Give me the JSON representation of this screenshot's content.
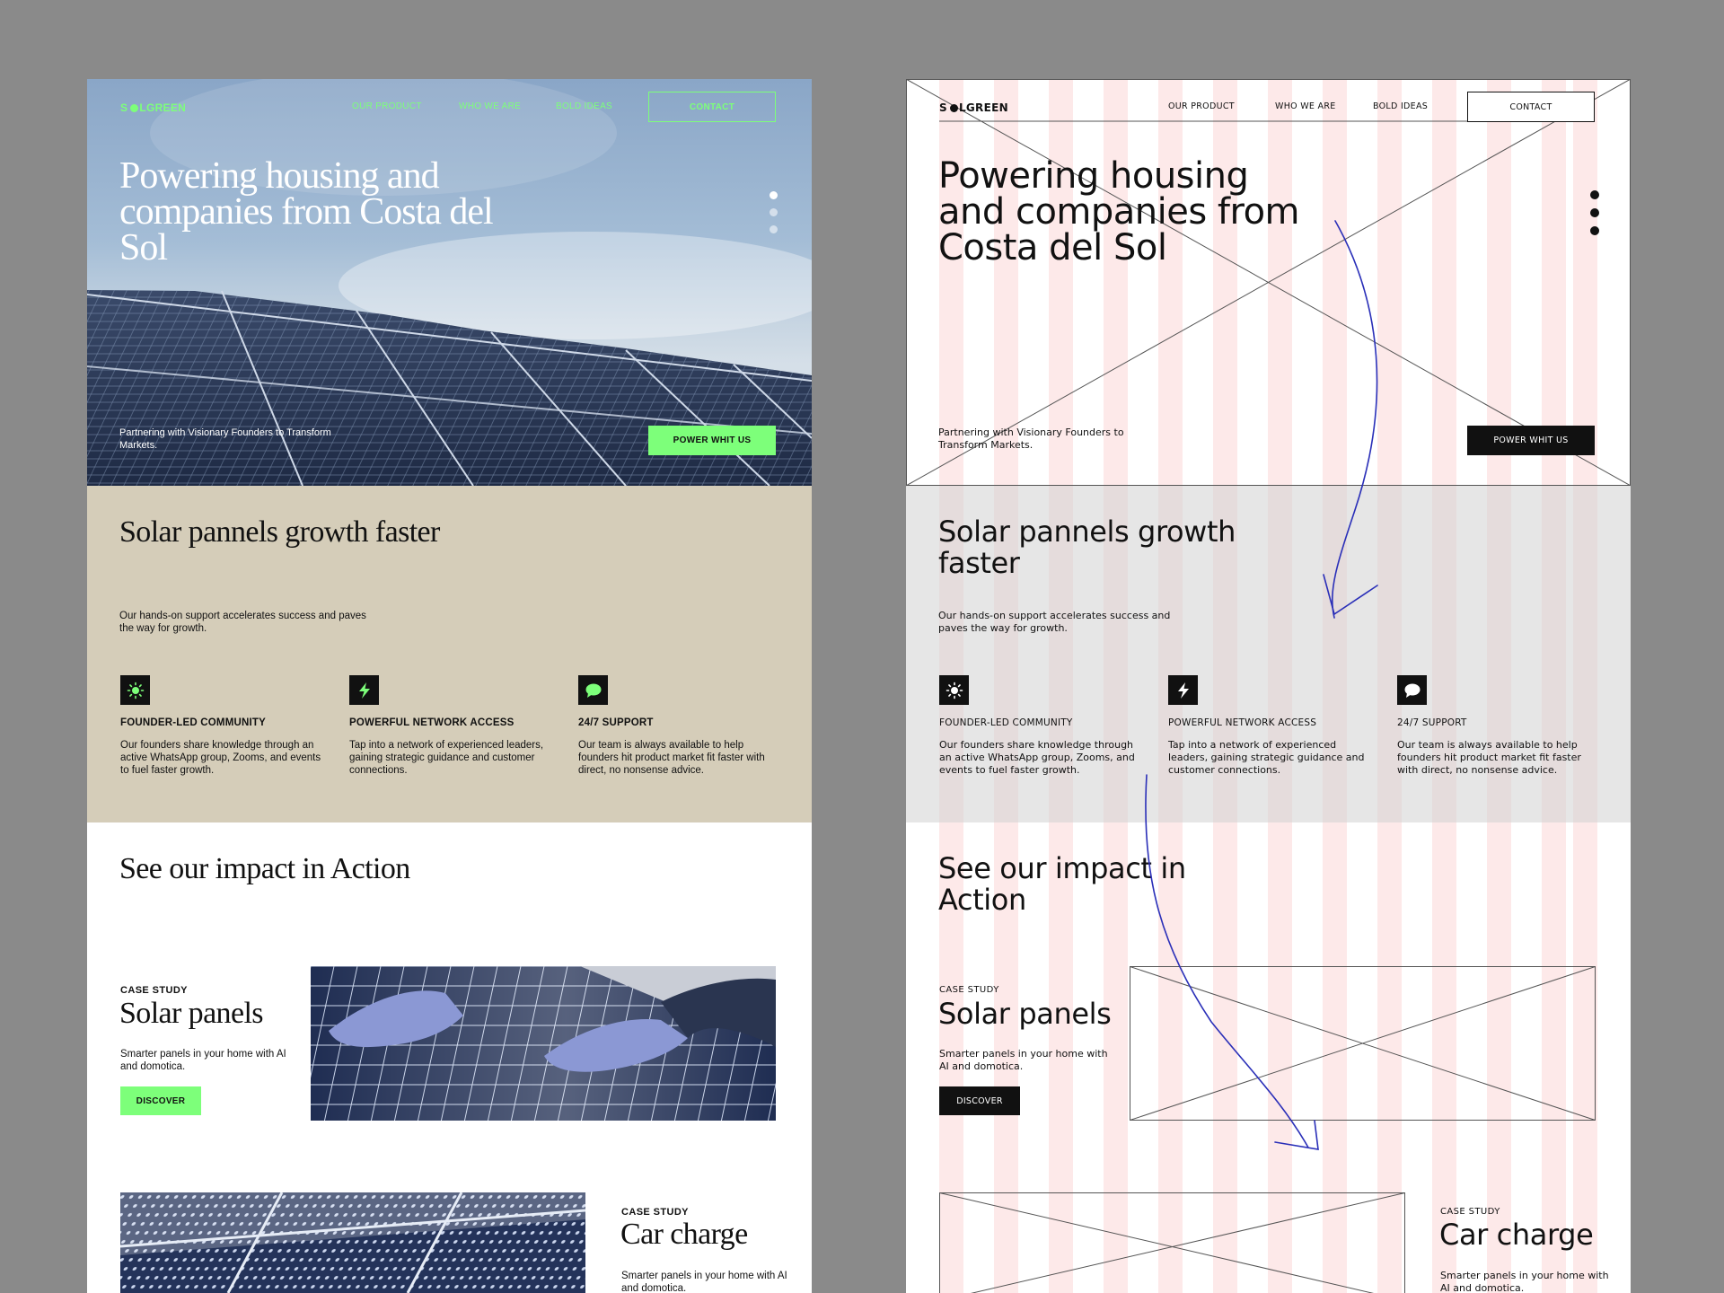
{
  "brand": {
    "logo_pre": "S",
    "logo_post": "LGREEN",
    "accent": "#7dff7a",
    "sand": "#d5cdb9"
  },
  "nav": {
    "our_product": "OUR PRODUCT",
    "who_we_are": "WHO WE ARE",
    "bold_ideas": "BOLD IDEAS",
    "contact": "CONTACT"
  },
  "hero": {
    "title": "Powering housing and companies from Costa del Sol",
    "subtitle": "Partnering with Visionary Founders to Transform Markets.",
    "cta": "POWER WHIT US"
  },
  "growth": {
    "title": "Solar pannels growth faster",
    "subtitle": "Our hands-on support accelerates success and paves the way for growth.",
    "features": [
      {
        "icon": "sun-icon",
        "title": "FOUNDER-LED COMMUNITY",
        "text": "Our founders share knowledge through an active WhatsApp group, Zooms, and events to fuel faster growth."
      },
      {
        "icon": "lightning-icon",
        "title": "POWERFUL NETWORK ACCESS",
        "text": "Tap into a network of experienced leaders, gaining strategic guidance and customer connections."
      },
      {
        "icon": "chat-bubble-icon",
        "title": "24/7 SUPPORT",
        "text": "Our team is always available to help founders hit product market fit faster with direct, no nonsense advice."
      }
    ]
  },
  "impact": {
    "title": "See our impact in Action",
    "cases": [
      {
        "tag": "CASE STUDY",
        "title": "Solar panels",
        "text": "Smarter panels in your home with AI and domotica.",
        "cta": "DISCOVER"
      },
      {
        "tag": "CASE STUDY",
        "title": "Car charge",
        "text": "Smarter panels in your home with AI and domotica."
      }
    ]
  }
}
